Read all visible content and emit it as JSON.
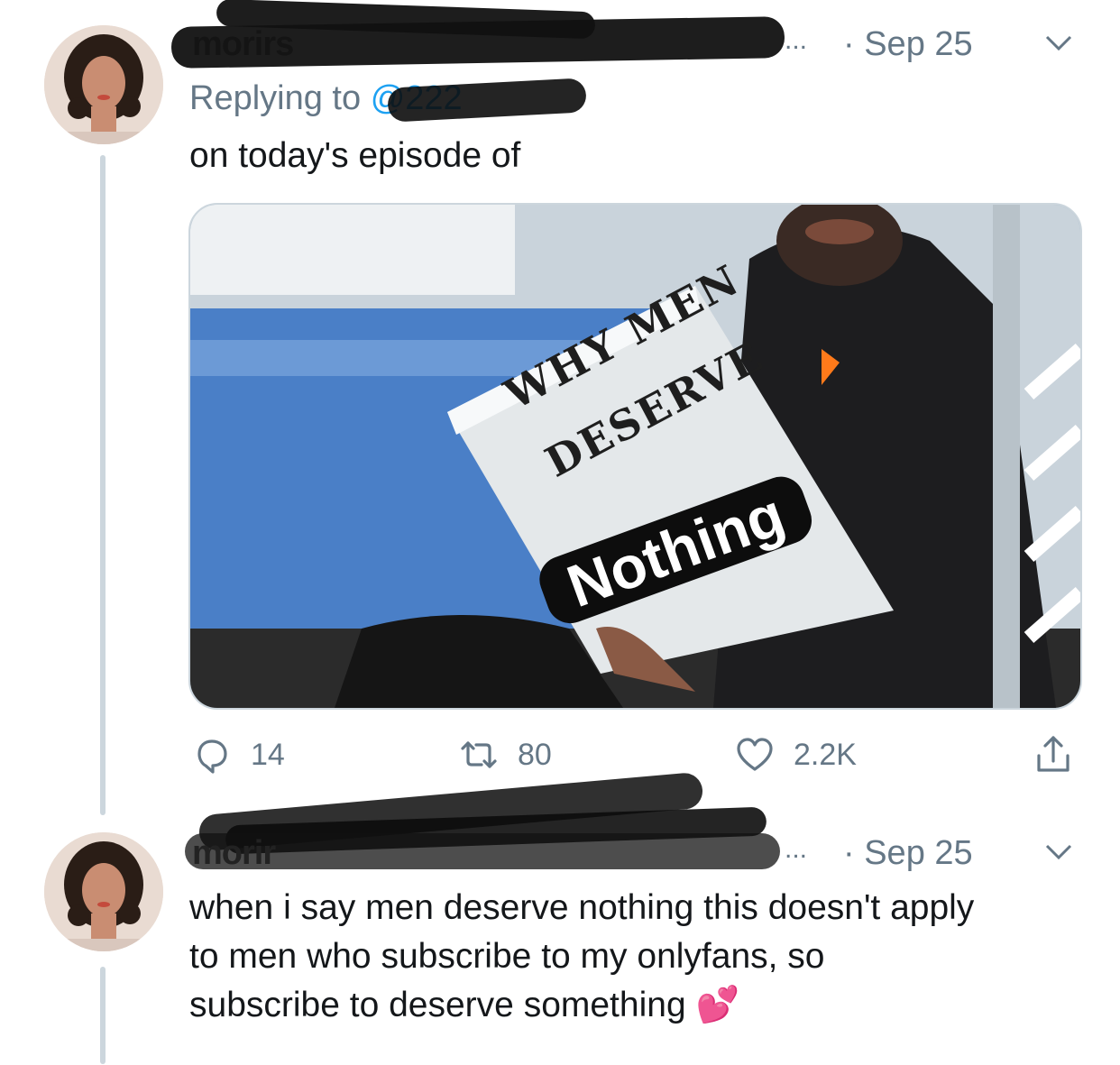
{
  "tweets": [
    {
      "name": "morirs",
      "ellipsis": "...",
      "date": "· Sep 25",
      "replying_prefix": "Replying to",
      "replying_handle": "@222",
      "text": "on today's episode of",
      "media": {
        "book_line1": "WHY MEN",
        "book_line2": "DESERVE",
        "overlay_text": "Nothing"
      },
      "actions": {
        "replies": "14",
        "retweets": "80",
        "likes": "2.2K"
      }
    },
    {
      "name": "morir",
      "ellipsis": "...",
      "date": "· Sep 25",
      "text": "when i say men deserve nothing this doesn't apply\nto men who subscribe to my onlyfans, so\nsubscribe to deserve something",
      "emoji": "💕"
    }
  ],
  "icons": {
    "reply": "reply-bubble-icon",
    "retweet": "retweet-icon",
    "like": "heart-icon",
    "share": "share-icon",
    "caret": "chevron-down-icon"
  },
  "colors": {
    "muted": "#657786",
    "link": "#1da1f2",
    "border": "#ccd6dd"
  }
}
